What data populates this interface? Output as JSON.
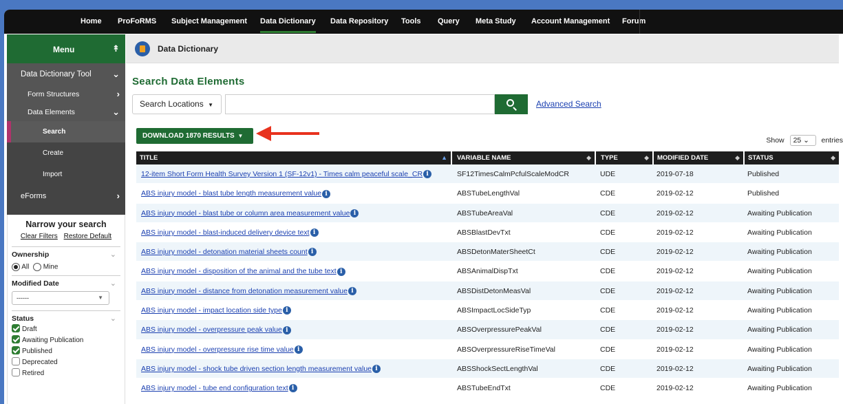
{
  "nav": {
    "items": [
      {
        "label": "Home",
        "active": false
      },
      {
        "label": "ProFoRMS",
        "active": false
      },
      {
        "label": "Subject Management",
        "active": false
      },
      {
        "label": "Data Dictionary",
        "active": true
      },
      {
        "label": "Data Repository",
        "active": false
      },
      {
        "label": "Tools",
        "active": false
      },
      {
        "label": "Query",
        "active": false
      },
      {
        "label": "Meta Study",
        "active": false
      },
      {
        "label": "Account Management",
        "active": false
      },
      {
        "label": "Forum",
        "active": false
      }
    ]
  },
  "sidebar": {
    "menu_label": "Menu",
    "tool_label": "Data Dictionary Tool",
    "form_structures": "Form Structures",
    "data_elements": "Data Elements",
    "search": "Search",
    "create": "Create",
    "import": "Import",
    "eforms": "eForms"
  },
  "filters": {
    "narrow_title": "Narrow your search",
    "clear_filters": "Clear Filters",
    "restore_default": "Restore Default",
    "ownership_title": "Ownership",
    "ownership_all": "All",
    "ownership_mine": "Mine",
    "modified_title": "Modified Date",
    "modified_value": "------",
    "status_title": "Status",
    "statuses": [
      {
        "label": "Draft",
        "checked": true
      },
      {
        "label": "Awaiting Publication",
        "checked": true
      },
      {
        "label": "Published",
        "checked": true
      },
      {
        "label": "Deprecated",
        "checked": false
      },
      {
        "label": "Retired",
        "checked": false
      }
    ]
  },
  "breadcrumb": {
    "title": "Data Dictionary"
  },
  "main": {
    "title": "Search Data Elements",
    "search_locations": "Search Locations",
    "search_placeholder": "",
    "advanced_search": "Advanced Search",
    "download_label": "DOWNLOAD 1870 RESULTS",
    "show_label": "Show",
    "entries_value": "25",
    "entries_label": "entries"
  },
  "table": {
    "headers": [
      "TITLE",
      "VARIABLE NAME",
      "TYPE",
      "MODIFIED DATE",
      "STATUS"
    ],
    "rows": [
      [
        "12-item Short Form Health Survey Version 1 (SF-12v1) - Times calm peaceful scale_CR",
        "SF12TimesCalmPcfulScaleModCR",
        "UDE",
        "2019-07-18",
        "Published"
      ],
      [
        "ABS injury model - blast tube length measurement value",
        "ABSTubeLengthVal",
        "CDE",
        "2019-02-12",
        "Published"
      ],
      [
        "ABS injury model - blast tube or column area measurement value",
        "ABSTubeAreaVal",
        "CDE",
        "2019-02-12",
        "Awaiting Publication"
      ],
      [
        "ABS injury model - blast-induced delivery device text",
        "ABSBlastDevTxt",
        "CDE",
        "2019-02-12",
        "Awaiting Publication"
      ],
      [
        "ABS injury model - detonation material sheets count",
        "ABSDetonMaterSheetCt",
        "CDE",
        "2019-02-12",
        "Awaiting Publication"
      ],
      [
        "ABS injury model - disposition of the animal and the tube text",
        "ABSAnimalDispTxt",
        "CDE",
        "2019-02-12",
        "Awaiting Publication"
      ],
      [
        "ABS injury model - distance from detonation measurement value",
        "ABSDistDetonMeasVal",
        "CDE",
        "2019-02-12",
        "Awaiting Publication"
      ],
      [
        "ABS injury model - impact location side type",
        "ABSImpactLocSideTyp",
        "CDE",
        "2019-02-12",
        "Awaiting Publication"
      ],
      [
        "ABS injury model - overpressure peak value",
        "ABSOverpressurePeakVal",
        "CDE",
        "2019-02-12",
        "Awaiting Publication"
      ],
      [
        "ABS injury model - overpressure rise time value",
        "ABSOverpressureRiseTimeVal",
        "CDE",
        "2019-02-12",
        "Awaiting Publication"
      ],
      [
        "ABS injury model - shock tube driven section length measurement value",
        "ABSShockSectLengthVal",
        "CDE",
        "2019-02-12",
        "Awaiting Publication"
      ],
      [
        "ABS injury model - tube end configuration text",
        "ABSTubeEndTxt",
        "CDE",
        "2019-02-12",
        "Awaiting Publication"
      ]
    ]
  },
  "colors": {
    "brand_green": "#1f6b33",
    "nav_bg": "#111111",
    "link": "#1a3fb0",
    "arrow": "#e8321e",
    "active_marker": "#b0336b"
  }
}
